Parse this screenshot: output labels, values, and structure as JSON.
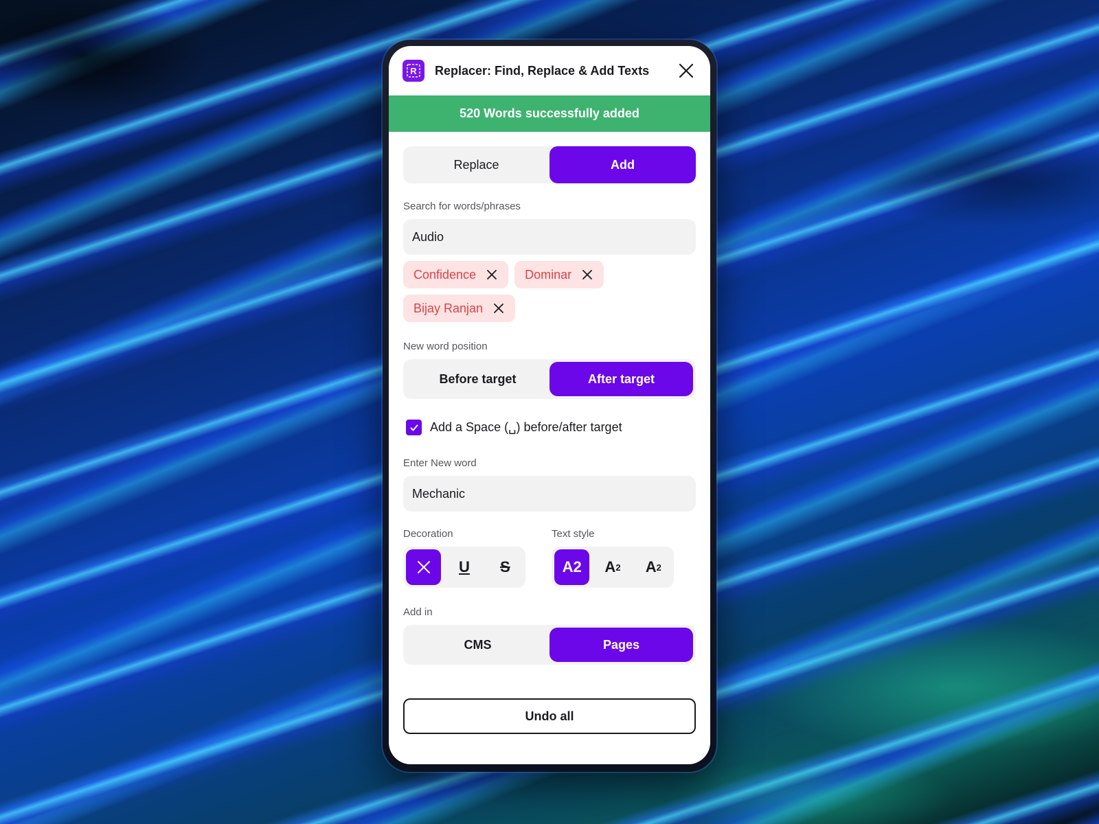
{
  "window": {
    "title": "Replacer: Find, Replace & Add Texts",
    "app_icon_letter": "R"
  },
  "banner": {
    "text": "520 Words successfully added",
    "color": "#3eb370"
  },
  "mode_tabs": [
    {
      "label": "Replace",
      "active": false
    },
    {
      "label": "Add",
      "active": true
    }
  ],
  "search": {
    "label": "Search for words/phrases",
    "value": "Audio",
    "tags": [
      "Confidence",
      "Dominar",
      "Bijay Ranjan"
    ]
  },
  "position": {
    "label": "New word position",
    "options": [
      {
        "label": "Before target",
        "active": false
      },
      {
        "label": "After target",
        "active": true
      }
    ]
  },
  "space_option": {
    "label": "Add a Space (␣) before/after target",
    "checked": true
  },
  "new_word": {
    "label": "Enter New word",
    "value": "Mechanic"
  },
  "decoration": {
    "label": "Decoration",
    "options": [
      {
        "name": "none-icon",
        "active": true
      },
      {
        "name": "underline",
        "glyph": "U",
        "active": false
      },
      {
        "name": "strikethrough",
        "glyph": "S",
        "active": false
      }
    ]
  },
  "text_style": {
    "label": "Text style",
    "normal": "A2",
    "superscript_base": "A",
    "superscript_mark": "2",
    "subscript_base": "A",
    "subscript_mark": "2"
  },
  "add_in": {
    "label": "Add in",
    "options": [
      {
        "label": "CMS",
        "active": false
      },
      {
        "label": "Pages",
        "active": true
      }
    ]
  },
  "undo_all": "Undo all",
  "colors": {
    "accent": "#6b07e8",
    "tag_bg": "#fde3e3",
    "tag_text": "#d9434a"
  }
}
